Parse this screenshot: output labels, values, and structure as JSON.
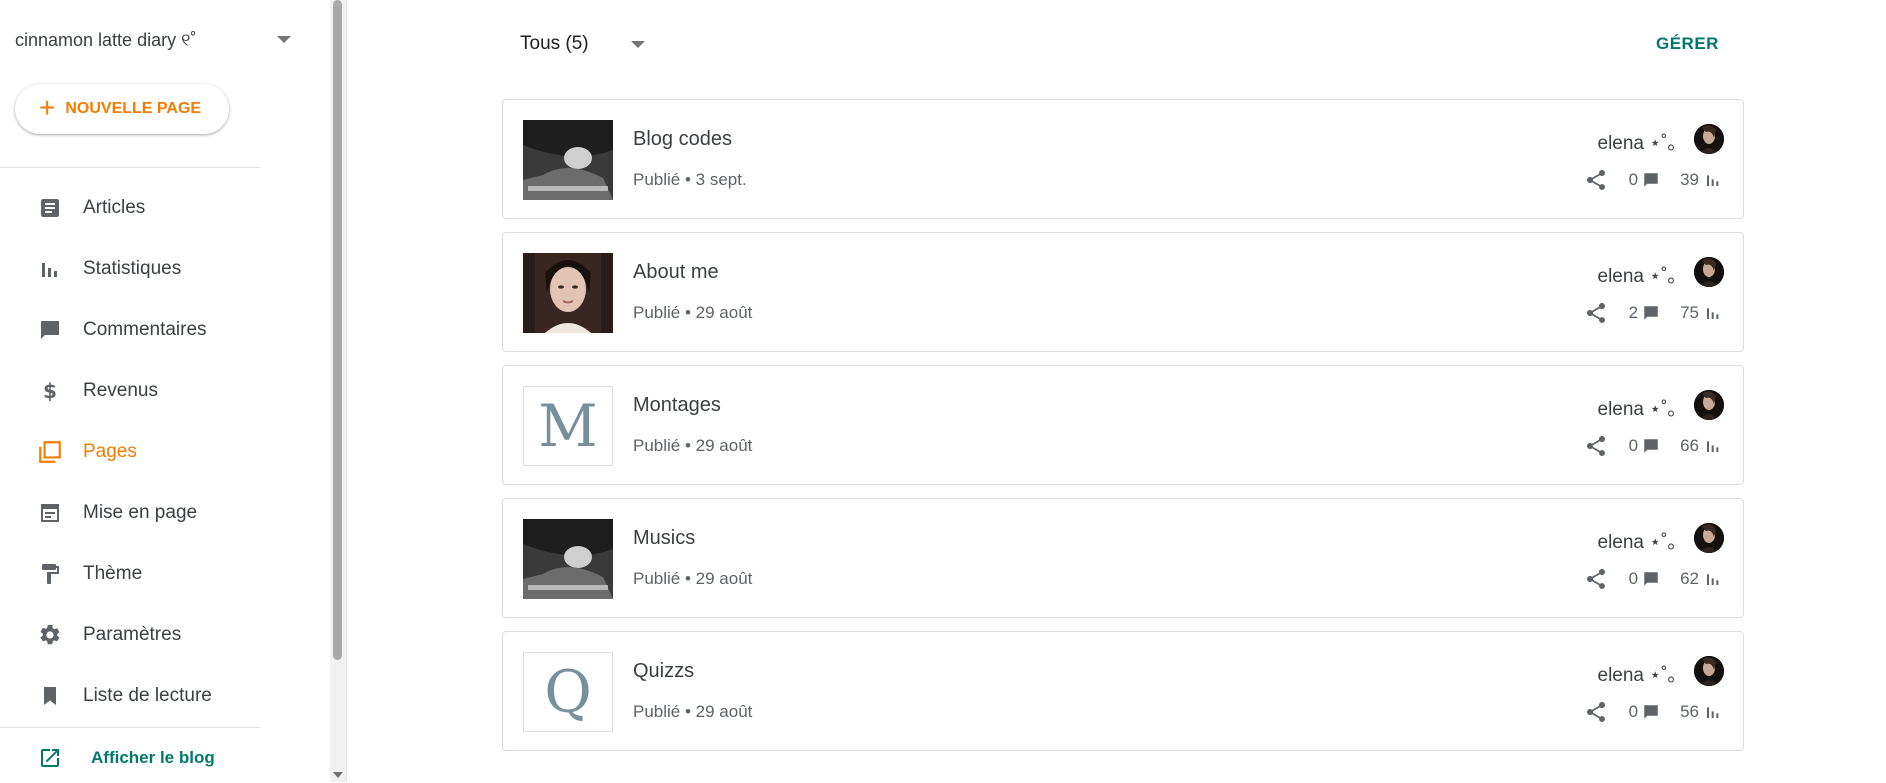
{
  "sidebar": {
    "blog_name": "cinnamon latte diary ୧˚",
    "new_page_label": "NOUVELLE PAGE",
    "items": [
      {
        "label": "Articles",
        "icon": "article-icon"
      },
      {
        "label": "Statistiques",
        "icon": "bar-chart-icon"
      },
      {
        "label": "Commentaires",
        "icon": "comment-icon"
      },
      {
        "label": "Revenus",
        "icon": "dollar-icon"
      },
      {
        "label": "Pages",
        "icon": "pages-icon",
        "active": true
      },
      {
        "label": "Mise en page",
        "icon": "layout-icon"
      },
      {
        "label": "Thème",
        "icon": "paint-roller-icon"
      },
      {
        "label": "Paramètres",
        "icon": "gear-icon"
      },
      {
        "label": "Liste de lecture",
        "icon": "bookmark-icon"
      }
    ],
    "view_blog_label": "Afficher le blog"
  },
  "main": {
    "filter_label": "Tous (5)",
    "manage_label": "GÉRER",
    "pages": [
      {
        "title": "Blog codes",
        "status": "Publié • 3 sept.",
        "author": "elena ⋆˚｡",
        "comments": "0",
        "views": "39",
        "thumb": "photo-dark"
      },
      {
        "title": "About me",
        "status": "Publié • 29 août",
        "author": "elena ⋆˚｡",
        "comments": "2",
        "views": "75",
        "thumb": "photo-portrait"
      },
      {
        "title": "Montages",
        "status": "Publié • 29 août",
        "author": "elena ⋆˚｡",
        "comments": "0",
        "views": "66",
        "thumb": "letter",
        "letter": "M"
      },
      {
        "title": "Musics",
        "status": "Publié • 29 août",
        "author": "elena ⋆˚｡",
        "comments": "0",
        "views": "62",
        "thumb": "photo-dark"
      },
      {
        "title": "Quizzs",
        "status": "Publié • 29 août",
        "author": "elena ⋆˚｡",
        "comments": "0",
        "views": "56",
        "thumb": "letter",
        "letter": "Q"
      }
    ]
  },
  "colors": {
    "accent_orange": "#f57c00",
    "accent_teal": "#00796b",
    "icon_gray": "#5f6368",
    "letter_gray": "#78909c"
  }
}
